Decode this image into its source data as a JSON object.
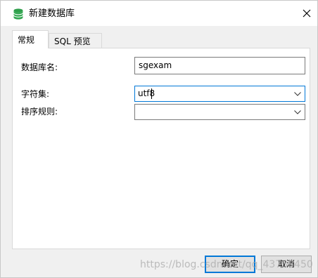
{
  "window": {
    "title": "新建数据库",
    "icon": "database-icon",
    "close_icon": "close-icon"
  },
  "tabs": [
    {
      "label": "常规",
      "active": true
    },
    {
      "label": "SQL 预览",
      "active": false
    }
  ],
  "form": {
    "db_name": {
      "label": "数据库名:",
      "value": "sgexam"
    },
    "charset": {
      "label": "字符集:",
      "value": "utf8"
    },
    "collation": {
      "label": "排序规则:",
      "value": ""
    }
  },
  "buttons": {
    "ok": "确定",
    "cancel": "取消"
  },
  "watermark": "https://blog.csdn.net/qq_43738450",
  "colors": {
    "accent": "#0078d7",
    "db_icon": "#2e9e4a"
  }
}
